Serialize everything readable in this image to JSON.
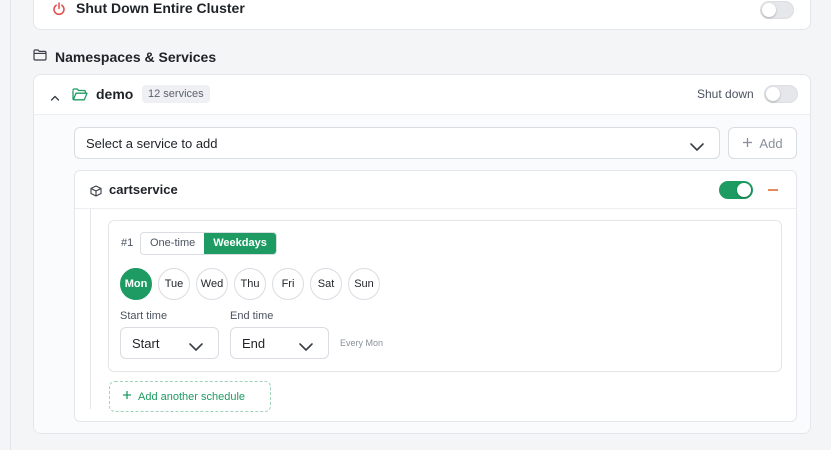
{
  "cluster": {
    "shutdown_label": "Shut Down Entire Cluster",
    "shutdown_enabled": false
  },
  "section": {
    "title": "Namespaces & Services"
  },
  "namespace": {
    "name": "demo",
    "badge": "12 services",
    "shutdown_label": "Shut down",
    "shutdown_enabled": false,
    "service_select_placeholder": "Select a service to add",
    "add_label": "Add"
  },
  "service": {
    "name": "cartservice",
    "enabled": true,
    "schedule": {
      "number": "#1",
      "modes": [
        "One-time",
        "Weekdays"
      ],
      "active_mode": "Weekdays",
      "days": [
        "Mon",
        "Tue",
        "Wed",
        "Thu",
        "Fri",
        "Sat",
        "Sun"
      ],
      "active_day": "Mon",
      "start_label": "Start time",
      "start_value": "Start",
      "end_label": "End time",
      "end_value": "End",
      "summary": "Every Mon"
    },
    "add_schedule_label": "Add another schedule"
  },
  "colors": {
    "accent": "#1e9b62",
    "danger": "#e24c4c",
    "minus": "#e38d5d"
  }
}
